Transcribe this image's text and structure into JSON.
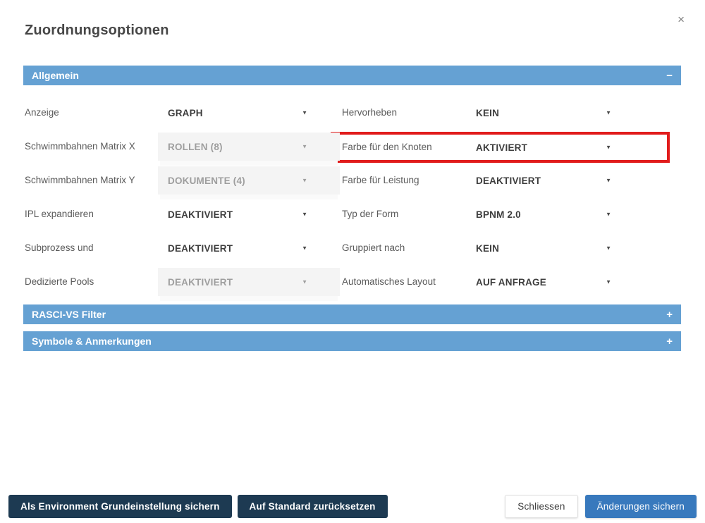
{
  "dialog": {
    "title": "Zuordnungsoptionen",
    "close_icon": "×"
  },
  "sections": [
    {
      "label": "Allgemein",
      "toggle": "−",
      "expanded": true
    },
    {
      "label": "RASCI-VS Filter",
      "toggle": "+",
      "expanded": false
    },
    {
      "label": "Symbole & Anmerkungen",
      "toggle": "+",
      "expanded": false
    }
  ],
  "fields": {
    "left": [
      {
        "label": "Anzeige",
        "value": "GRAPH",
        "disabled": false
      },
      {
        "label": "Schwimmbahnen Matrix X",
        "value": "ROLLEN (8)",
        "disabled": true
      },
      {
        "label": "Schwimmbahnen Matrix Y",
        "value": "DOKUMENTE (4)",
        "disabled": true
      },
      {
        "label": "IPL expandieren",
        "value": "DEAKTIVIERT",
        "disabled": false
      },
      {
        "label": "Subprozess und",
        "value": "DEAKTIVIERT",
        "disabled": false
      },
      {
        "label": "Dedizierte Pools",
        "value": "DEAKTIVIERT",
        "disabled": true
      }
    ],
    "right": [
      {
        "label": "Hervorheben",
        "value": "KEIN",
        "disabled": false,
        "highlighted": false
      },
      {
        "label": "Farbe für den Knoten",
        "value": "AKTIVIERT",
        "disabled": false,
        "highlighted": true
      },
      {
        "label": "Farbe für Leistung",
        "value": "DEAKTIVIERT",
        "disabled": false,
        "highlighted": false
      },
      {
        "label": "Typ der Form",
        "value": "BPNM 2.0",
        "disabled": false,
        "highlighted": false
      },
      {
        "label": "Gruppiert nach",
        "value": "KEIN",
        "disabled": false,
        "highlighted": false
      },
      {
        "label": "Automatisches Layout",
        "value": "AUF ANFRAGE",
        "disabled": false,
        "highlighted": false
      }
    ]
  },
  "footer": {
    "buttons_left": [
      {
        "label": "Als Environment Grundeinstellung sichern",
        "style": "dark"
      },
      {
        "label": "Auf Standard zurücksetzen",
        "style": "dark"
      }
    ],
    "buttons_right": [
      {
        "label": "Schliessen",
        "style": "light"
      },
      {
        "label": "Änderungen sichern",
        "style": "primary"
      }
    ]
  },
  "colors": {
    "section_header_bg": "#65a1d3",
    "primary_button_bg": "#3879bd",
    "dark_button_bg": "#1d3a52",
    "highlight_border": "#e11c1c",
    "disabled_field_bg": "#f4f4f4"
  }
}
